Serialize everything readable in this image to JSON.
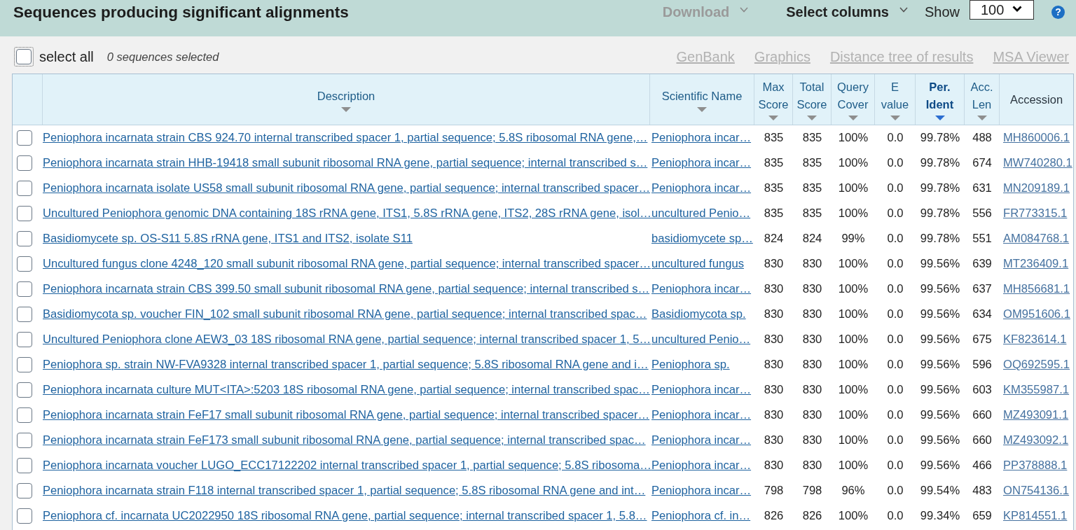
{
  "header": {
    "title": "Sequences producing significant alignments",
    "actions": [
      {
        "kind": "menu",
        "label": "Download",
        "disabled": true
      },
      {
        "kind": "menu",
        "label": "Select columns",
        "disabled": false
      }
    ],
    "show": {
      "label": "Show",
      "value": "100"
    },
    "help": {
      "label": "?"
    }
  },
  "toolbar": {
    "select_all": {
      "label": "select all",
      "checked": false,
      "focused": true
    },
    "selection_count": "0 sequences selected",
    "links": [
      {
        "label": "GenBank",
        "disabled": true
      },
      {
        "label": "Graphics",
        "disabled": true
      },
      {
        "label": "Distance tree of results",
        "disabled": true
      },
      {
        "label": "MSA Viewer",
        "disabled": true
      }
    ]
  },
  "table": {
    "columns": [
      {
        "label": "Description",
        "kind": "link",
        "sortable": true,
        "sorted": false
      },
      {
        "label": "Scientific Name",
        "kind": "link",
        "sortable": true,
        "sorted": false
      },
      {
        "label": "Max Score",
        "kind": "number",
        "sortable": true,
        "sorted": false
      },
      {
        "label": "Total Score",
        "kind": "number",
        "sortable": true,
        "sorted": false
      },
      {
        "label": "Query Cover",
        "kind": "number",
        "sortable": true,
        "sorted": false
      },
      {
        "label": "E value",
        "kind": "number",
        "sortable": true,
        "sorted": false
      },
      {
        "label": "Per. Ident",
        "kind": "number",
        "sortable": true,
        "sorted": true
      },
      {
        "label": "Acc. Len",
        "kind": "number",
        "sortable": true,
        "sorted": false
      },
      {
        "label": "Accession",
        "kind": "link",
        "sortable": false,
        "sorted": false
      }
    ],
    "rows": [
      {
        "checked": false,
        "cells": [
          "Peniophora incarnata strain CBS 924.70 internal transcribed spacer 1, partial sequence; 5.8S ribosomal RNA gene,…",
          "Peniophora incar…",
          "835",
          "835",
          "100%",
          "0.0",
          "99.78%",
          "488",
          "MH860006.1"
        ]
      },
      {
        "checked": false,
        "cells": [
          "Peniophora incarnata strain HHB-19418 small subunit ribosomal RNA gene, partial sequence; internal transcribed s…",
          "Peniophora incar…",
          "835",
          "835",
          "100%",
          "0.0",
          "99.78%",
          "674",
          "MW740280.1"
        ]
      },
      {
        "checked": false,
        "cells": [
          "Peniophora incarnata isolate US58 small subunit ribosomal RNA gene, partial sequence; internal transcribed spacer…",
          "Peniophora incar…",
          "835",
          "835",
          "100%",
          "0.0",
          "99.78%",
          "631",
          "MN209189.1"
        ]
      },
      {
        "checked": false,
        "cells": [
          "Uncultured Peniophora genomic DNA containing 18S rRNA gene, ITS1, 5.8S rRNA gene, ITS2, 28S rRNA gene, isol…",
          "uncultured Penio…",
          "835",
          "835",
          "100%",
          "0.0",
          "99.78%",
          "556",
          "FR773315.1"
        ]
      },
      {
        "checked": false,
        "cells": [
          "Basidiomycete sp. OS-S11 5.8S rRNA gene, ITS1 and ITS2, isolate S11",
          "basidiomycete sp…",
          "824",
          "824",
          "99%",
          "0.0",
          "99.78%",
          "551",
          "AM084768.1"
        ]
      },
      {
        "checked": false,
        "cells": [
          "Uncultured fungus clone 4248_120 small subunit ribosomal RNA gene, partial sequence; internal transcribed spacer…",
          "uncultured fungus",
          "830",
          "830",
          "100%",
          "0.0",
          "99.56%",
          "639",
          "MT236409.1"
        ]
      },
      {
        "checked": false,
        "cells": [
          "Peniophora incarnata strain CBS 399.50 small subunit ribosomal RNA gene, partial sequence; internal transcribed s…",
          "Peniophora incar…",
          "830",
          "830",
          "100%",
          "0.0",
          "99.56%",
          "637",
          "MH856681.1"
        ]
      },
      {
        "checked": false,
        "cells": [
          "Basidiomycota sp. voucher FIN_102 small subunit ribosomal RNA gene, partial sequence; internal transcribed spac…",
          "Basidiomycota sp.",
          "830",
          "830",
          "100%",
          "0.0",
          "99.56%",
          "634",
          "OM951606.1"
        ]
      },
      {
        "checked": false,
        "cells": [
          "Uncultured Peniophora clone AEW3_03 18S ribosomal RNA gene, partial sequence; internal transcribed spacer 1, 5…",
          "uncultured Penio…",
          "830",
          "830",
          "100%",
          "0.0",
          "99.56%",
          "675",
          "KF823614.1"
        ]
      },
      {
        "checked": false,
        "cells": [
          "Peniophora sp. strain NW-FVA9328 internal transcribed spacer 1, partial sequence; 5.8S ribosomal RNA gene and i…",
          "Peniophora sp.",
          "830",
          "830",
          "100%",
          "0.0",
          "99.56%",
          "596",
          "OQ692595.1"
        ]
      },
      {
        "checked": false,
        "cells": [
          "Peniophora incarnata culture MUT<ITA>:5203 18S ribosomal RNA gene, partial sequence; internal transcribed spac…",
          "Peniophora incar…",
          "830",
          "830",
          "100%",
          "0.0",
          "99.56%",
          "603",
          "KM355987.1"
        ]
      },
      {
        "checked": false,
        "cells": [
          "Peniophora incarnata strain FeF17 small subunit ribosomal RNA gene, partial sequence; internal transcribed spacer…",
          "Peniophora incar…",
          "830",
          "830",
          "100%",
          "0.0",
          "99.56%",
          "660",
          "MZ493091.1"
        ]
      },
      {
        "checked": false,
        "cells": [
          "Peniophora incarnata strain FeF173 small subunit ribosomal RNA gene, partial sequence; internal transcribed spac…",
          "Peniophora incar…",
          "830",
          "830",
          "100%",
          "0.0",
          "99.56%",
          "660",
          "MZ493092.1"
        ]
      },
      {
        "checked": false,
        "cells": [
          "Peniophora incarnata voucher LUGO_ECC17122202 internal transcribed spacer 1, partial sequence; 5.8S ribosoma…",
          "Peniophora incar…",
          "830",
          "830",
          "100%",
          "0.0",
          "99.56%",
          "466",
          "PP378888.1"
        ]
      },
      {
        "checked": false,
        "cells": [
          "Peniophora incarnata strain F118 internal transcribed spacer 1, partial sequence; 5.8S ribosomal RNA gene and int…",
          "Peniophora incar…",
          "798",
          "798",
          "96%",
          "0.0",
          "99.54%",
          "483",
          "ON754136.1"
        ]
      },
      {
        "checked": false,
        "cells": [
          "Peniophora cf. incarnata UC2022950 18S ribosomal RNA gene, partial sequence; internal transcribed spacer 1, 5.8…",
          "Peniophora cf. in…",
          "826",
          "826",
          "100%",
          "0.0",
          "99.34%",
          "659",
          "KP814551.1"
        ]
      }
    ]
  }
}
